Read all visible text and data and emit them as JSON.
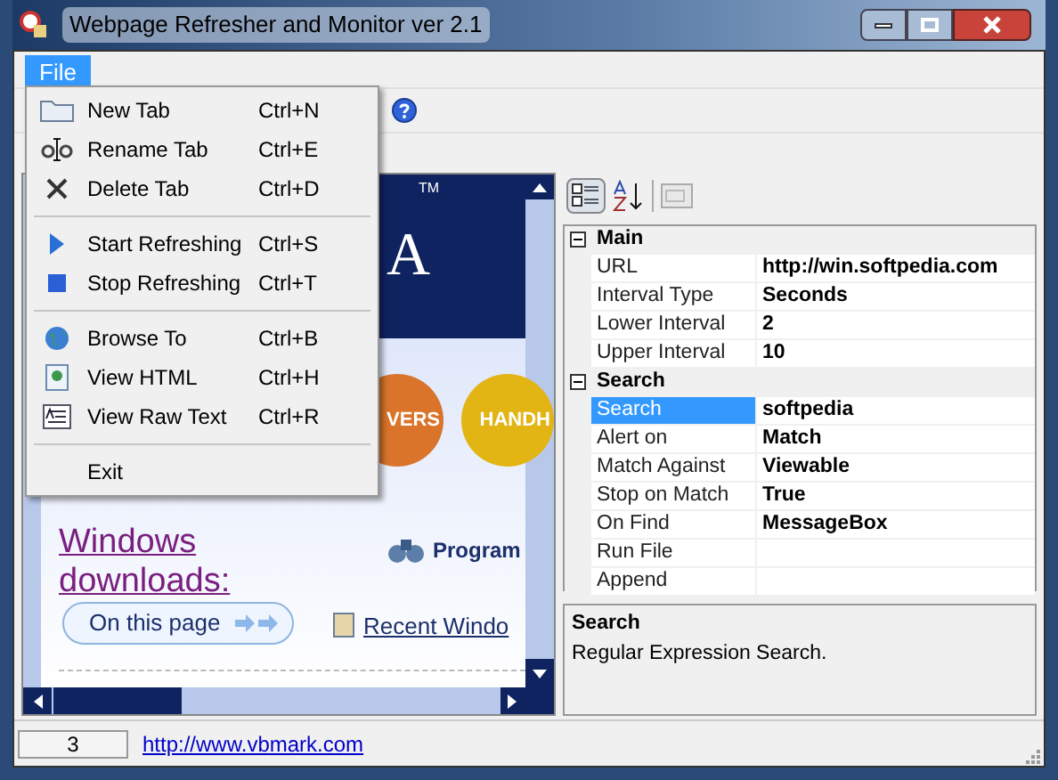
{
  "window": {
    "title": "Webpage Refresher and Monitor ver 2.1"
  },
  "menu_bar": [
    {
      "label": "File",
      "selected": true
    }
  ],
  "file_menu": [
    {
      "kind": "item",
      "label": "New Tab",
      "shortcut": "Ctrl+N"
    },
    {
      "kind": "item",
      "label": "Rename Tab",
      "shortcut": "Ctrl+E"
    },
    {
      "kind": "item",
      "label": "Delete Tab",
      "shortcut": "Ctrl+D"
    },
    {
      "kind": "separator"
    },
    {
      "kind": "item",
      "label": "Start Refreshing",
      "shortcut": "Ctrl+S"
    },
    {
      "kind": "item",
      "label": "Stop Refreshing",
      "shortcut": "Ctrl+T"
    },
    {
      "kind": "separator"
    },
    {
      "kind": "item",
      "label": "Browse To",
      "shortcut": "Ctrl+B"
    },
    {
      "kind": "item",
      "label": "View HTML",
      "shortcut": "Ctrl+H"
    },
    {
      "kind": "item",
      "label": "View Raw Text",
      "shortcut": "Ctrl+R"
    },
    {
      "kind": "separator"
    },
    {
      "kind": "item",
      "label": "Exit"
    }
  ],
  "browser": {
    "logo_letter": "A",
    "trademark": "TM",
    "orbs": [
      {
        "label": "VERS",
        "color": "#d9742a"
      },
      {
        "label": "HANDH",
        "color": "#e2b414"
      }
    ],
    "heading": "Windows downloads:",
    "page_button": "On this page",
    "links": [
      "Program",
      "Recent Windo"
    ]
  },
  "property_grid": {
    "categories": [
      {
        "name": "Main",
        "expanded": true,
        "rows": [
          {
            "name": "URL",
            "value": "http://win.softpedia.com",
            "selected": false
          },
          {
            "name": "Interval Type",
            "value": "Seconds",
            "selected": false
          },
          {
            "name": "Lower Interval",
            "value": "2",
            "selected": false
          },
          {
            "name": "Upper Interval",
            "value": "10",
            "selected": false
          }
        ]
      },
      {
        "name": "Search",
        "expanded": true,
        "rows": [
          {
            "name": "Search",
            "value": "softpedia",
            "selected": true
          },
          {
            "name": "Alert on",
            "value": "Match",
            "selected": false
          },
          {
            "name": "Match Against",
            "value": "Viewable",
            "selected": false
          },
          {
            "name": "Stop on Match",
            "value": "True",
            "selected": false
          },
          {
            "name": "On Find",
            "value": "MessageBox",
            "selected": false
          },
          {
            "name": "Run File",
            "selected": false
          },
          {
            "name": "Append",
            "selected": false
          }
        ]
      }
    ],
    "description": {
      "title": "Search",
      "text": "Regular Expression Search."
    }
  },
  "status_bar": {
    "count": "3",
    "link": "http://www.vbmark.com"
  }
}
